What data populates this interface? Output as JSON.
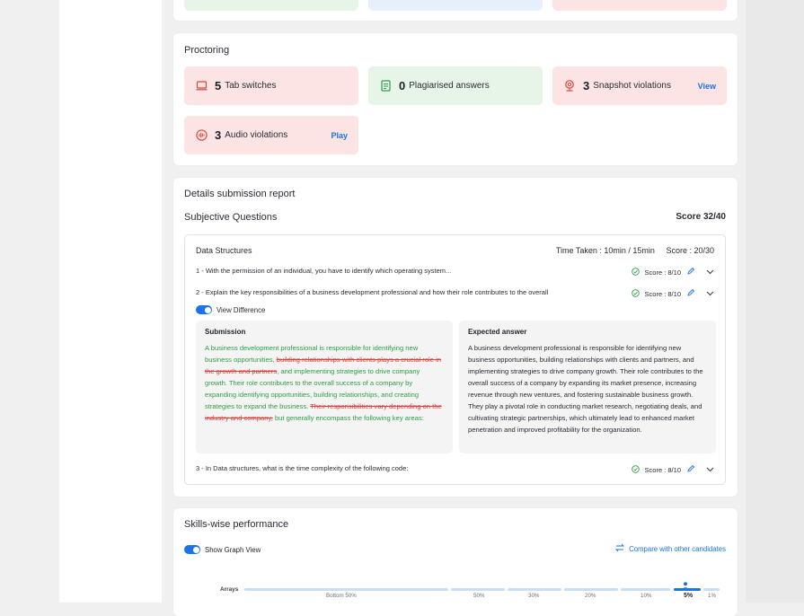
{
  "proctoring": {
    "title": "Proctoring",
    "tab_switches": {
      "count": "5",
      "label": "Tab switches"
    },
    "plagiarised": {
      "count": "0",
      "label": "Plagiarised answers"
    },
    "snapshot": {
      "count": "3",
      "label": "Snapshot violations",
      "action": "View"
    },
    "audio": {
      "count": "3",
      "label": "Audio violations",
      "action": "Play"
    }
  },
  "details": {
    "title": "Details submission report",
    "section": "Subjective Questions",
    "score": "Score 32/40",
    "topic": {
      "name": "Data Structures",
      "time_taken": "Time Taken : 10min / 15min",
      "score": "Score : 20/30"
    },
    "questions": [
      {
        "text": "1 - With the permission of an individual, you have to identify which operating system...",
        "score": "Score : 8/10"
      },
      {
        "text": "2 - Explain the key responsibilities of a business development professional and how their role contributes to the overall",
        "score": "Score : 8/10"
      },
      {
        "text": "3 - In Data structures, what is the time complexity of the following code:",
        "score": "Score : 8/10"
      }
    ],
    "view_difference": "View Difference",
    "submission": {
      "title": "Submission",
      "parts": [
        {
          "t": "A business development professional is responsible for identifying new business opportunities, ",
          "k": "ins"
        },
        {
          "t": "building relationships with clients plays a crucial role in the growth and partners",
          "k": "del"
        },
        {
          "t": ", and implementing strategies to drive company growth. Their role contributes to the overall success of a company by expanding identifying opportunities, building relationships, and creating strategies to expand the business. ",
          "k": "ins"
        },
        {
          "t": "Their responsibilities vary depending on the industry and company,",
          "k": "del"
        },
        {
          "t": " but generally encompass the following key areas:",
          "k": "ins"
        }
      ]
    },
    "expected": {
      "title": "Expected answer",
      "text": "A business development professional is responsible for identifying new business opportunities, building relationships with clients and partners, and implementing strategies to drive company growth. Their role contributes to the overall success of a company by expanding its market presence, increasing revenue through new ventures, and fostering sustainable business growth. They play a pivotal role in conducting market research, negotiating deals, and cultivating strategic partnerships, which ultimately lead to enhanced market penetration and improved profitability for the organization."
    }
  },
  "skills": {
    "title": "Skills-wise performance",
    "toggle_label": "Show Graph View",
    "compare": "Compare with other candidates",
    "row_label": "Arrays",
    "ticks": [
      "Bottom 50%",
      "50%",
      "30%",
      "20%",
      "10%",
      "5%",
      "1%"
    ],
    "marker": "5%"
  },
  "colors": {
    "accent": "#1a73e8",
    "red_bg": "#fbe4e3",
    "green_bg": "#e7f4e8",
    "insert": "#2e9e44",
    "delete": "#e0413a"
  }
}
